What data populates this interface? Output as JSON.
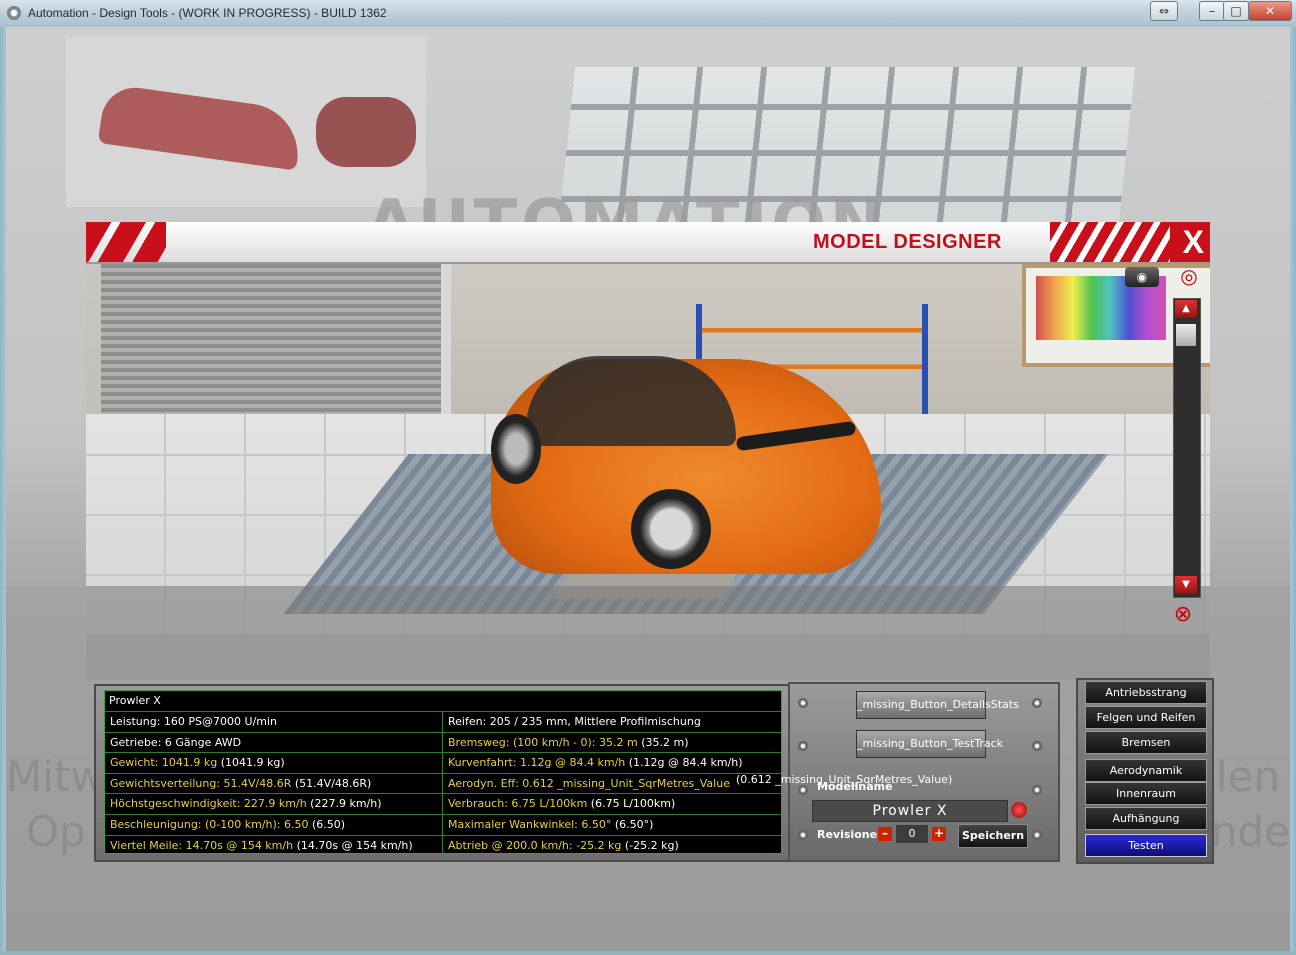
{
  "window": {
    "title": "Automation - Design Tools - (WORK IN PROGRESS) - BUILD 1362",
    "controls": {
      "restore": "⇔",
      "minimize": "–",
      "maximize": "□",
      "close": "✕"
    }
  },
  "background": {
    "logo": "AUTOMATION",
    "text_left_1": "Mitw",
    "text_left_2": "Op",
    "text_right_1": "len",
    "text_right_2": "nde"
  },
  "model_designer": {
    "title": "MODEL DESIGNER",
    "close_label": "X",
    "camera_icon": "camera-icon",
    "eye_icon": "eye-icon",
    "eye_off_icon": "eye-off-icon"
  },
  "stats": {
    "model_name": "Prowler X",
    "rows": [
      {
        "left": {
          "label": "Leistung: 160 PS@7000 U/min",
          "paren": ""
        },
        "right": {
          "label": "Reifen: 205 / 235 mm, Mittlere Profilmischung",
          "paren": ""
        }
      },
      {
        "left": {
          "label": "Getriebe: 6 Gänge AWD",
          "paren": ""
        },
        "right": {
          "label": "Bremsweg: (100 km/h - 0): 35.2 m",
          "paren": " (35.2 m)"
        }
      },
      {
        "left": {
          "label": "Gewicht: 1041.9 kg",
          "paren": " (1041.9 kg)"
        },
        "right": {
          "label": "Kurvenfahrt: 1.12g @ 84.4 km/h",
          "paren": " (1.12g @ 84.4 km/h)"
        }
      },
      {
        "left": {
          "label": "Gewichtsverteilung: 51.4V/48.6R",
          "paren": " (51.4V/48.6R)"
        },
        "right": {
          "label": "Aerodyn. Eff: 0.612 _missing_Unit_SqrMetres_Value",
          "paren": ""
        }
      },
      {
        "left": {
          "label": "Höchstgeschwindigkeit: 227.9 km/h",
          "paren": " (227.9 km/h)"
        },
        "right": {
          "label": "Verbrauch: 6.75 L/100km",
          "paren": " (6.75 L/100km)"
        }
      },
      {
        "left": {
          "label": "Beschleunigung: (0-100 km/h): 6.50",
          "paren": " (6.50)"
        },
        "right": {
          "label": "Maximaler Wankwinkel: 6.50°",
          "paren": " (6.50°)"
        }
      },
      {
        "left": {
          "label": "Viertel Meile: 14.70s @ 154 km/h",
          "paren": " (14.70s @ 154 km/h)"
        },
        "right": {
          "label": "Abtrieb @ 200.0 km/h: -25.2 kg",
          "paren": " (-25.2 kg)"
        }
      }
    ],
    "aero_overflow": "(0.612 _missing_Unit_SqrMetres_Value)"
  },
  "controls": {
    "details_button": "_missing_Button_DetailsStats",
    "testtrack_button": "_missing_Button_TestTrack",
    "model_name_label": "Modellname",
    "model_name_value": "Prowler X",
    "revisions_label": "Revisionen",
    "revision_minus": "–",
    "revision_value": "0",
    "revision_plus": "+",
    "save_button": "Speichern"
  },
  "nav": {
    "items": [
      "Antriebsstrang",
      "Felgen und Reifen",
      "Bremsen",
      "Aerodynamik",
      "Innenraum",
      "Aufhängung",
      "Testen"
    ],
    "active": "Testen"
  },
  "colors": {
    "accent_red": "#c90f1a",
    "stat_label": "#e7d23a",
    "stat_grid": "#2e7d2e",
    "active_nav": "#2a2ad8"
  }
}
